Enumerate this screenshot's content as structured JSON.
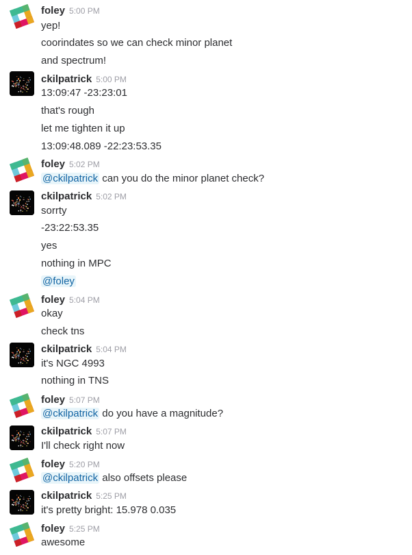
{
  "messages": [
    {
      "author": "foley",
      "avatar": "slack-logo",
      "time": "5:00 PM",
      "lines": [
        {
          "text": "yep!"
        },
        {
          "text": "coorindates so we can check minor planet"
        },
        {
          "text": "and spectrum!"
        }
      ]
    },
    {
      "author": "ckilpatrick",
      "avatar": "galaxy-image",
      "time": "5:00 PM",
      "lines": [
        {
          "text": "13:09:47 -23:23:01"
        },
        {
          "text": "that's rough"
        },
        {
          "text": "let me tighten it up"
        },
        {
          "text": "13:09:48.089 -22:23:53.35"
        }
      ]
    },
    {
      "author": "foley",
      "avatar": "slack-logo",
      "time": "5:02 PM",
      "lines": [
        {
          "mention": "@ckilpatrick",
          "text": " can you do the minor planet check?"
        }
      ]
    },
    {
      "author": "ckilpatrick",
      "avatar": "galaxy-image",
      "time": "5:02 PM",
      "lines": [
        {
          "text": "sorrty"
        },
        {
          "text": "-23:22:53.35"
        },
        {
          "text": "yes"
        },
        {
          "text": "nothing in MPC"
        },
        {
          "mention": "@foley",
          "text": ""
        }
      ]
    },
    {
      "author": "foley",
      "avatar": "slack-logo",
      "time": "5:04 PM",
      "lines": [
        {
          "text": "okay"
        },
        {
          "text": "check tns"
        }
      ]
    },
    {
      "author": "ckilpatrick",
      "avatar": "galaxy-image",
      "time": "5:04 PM",
      "lines": [
        {
          "text": "it's NGC 4993"
        },
        {
          "text": "nothing in TNS"
        }
      ]
    },
    {
      "author": "foley",
      "avatar": "slack-logo",
      "time": "5:07 PM",
      "lines": [
        {
          "mention": "@ckilpatrick",
          "text": " do you have a magnitude?"
        }
      ]
    },
    {
      "author": "ckilpatrick",
      "avatar": "galaxy-image",
      "time": "5:07 PM",
      "lines": [
        {
          "text": "I'll check right now"
        }
      ]
    },
    {
      "author": "foley",
      "avatar": "slack-logo",
      "time": "5:20 PM",
      "lines": [
        {
          "mention": "@ckilpatrick",
          "text": " also offsets please"
        }
      ]
    },
    {
      "author": "ckilpatrick",
      "avatar": "galaxy-image",
      "time": "5:25 PM",
      "lines": [
        {
          "text": "it's pretty bright: 15.978 0.035"
        }
      ]
    },
    {
      "author": "foley",
      "avatar": "slack-logo",
      "time": "5:25 PM",
      "lines": [
        {
          "text": "awesome"
        }
      ]
    }
  ]
}
